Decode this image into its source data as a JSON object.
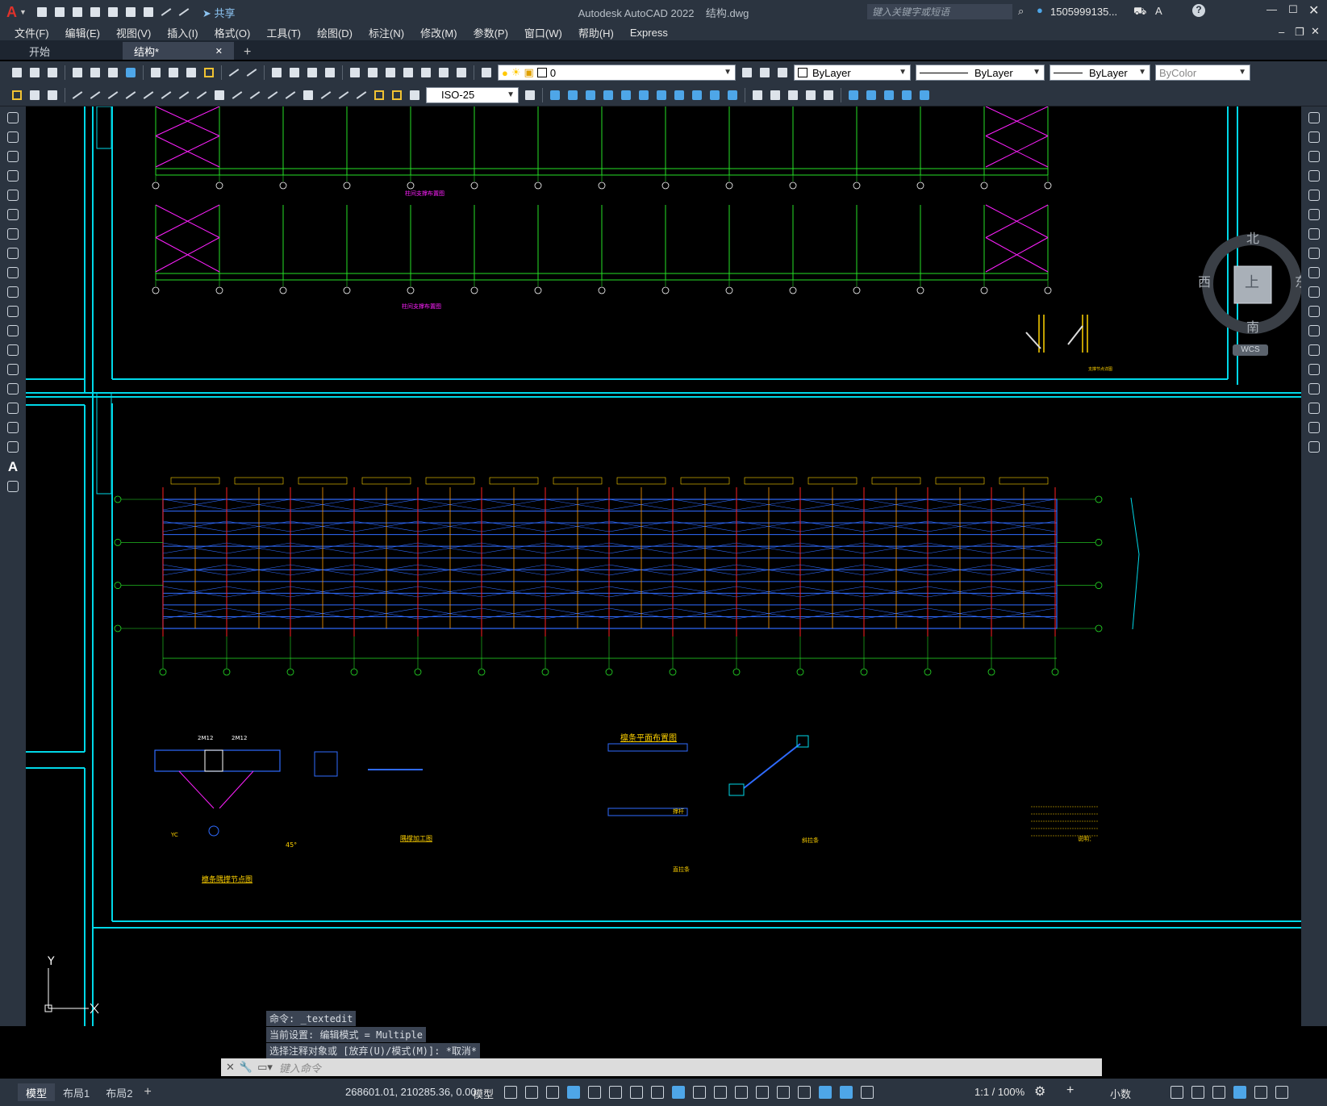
{
  "app": {
    "title": "Autodesk AutoCAD 2022",
    "filename": "结构.dwg",
    "search_placeholder": "键入关键字或短语",
    "user": "1505999135...",
    "share_label": "共享"
  },
  "menu": [
    "文件(F)",
    "编辑(E)",
    "视图(V)",
    "插入(I)",
    "格式(O)",
    "工具(T)",
    "绘图(D)",
    "标注(N)",
    "修改(M)",
    "参数(P)",
    "窗口(W)",
    "帮助(H)",
    "Express"
  ],
  "tabs": [
    {
      "label": "开始",
      "active": false
    },
    {
      "label": "结构*",
      "active": true
    }
  ],
  "toolbar": {
    "layer_value": "0",
    "color_value": "ByLayer",
    "linetype_value": "ByLayer",
    "lineweight_value": "ByLayer",
    "plotstyle_value": "ByColor",
    "dimstyle_value": "ISO-25"
  },
  "viewcube": {
    "north": "北",
    "south": "南",
    "east": "东",
    "west": "西",
    "top": "上",
    "wcs": "WCS"
  },
  "drawing": {
    "ucs_x": "X",
    "ucs_y": "Y",
    "caption_1": "柱间支撑布置图",
    "caption_2": "柱间支撑布置图",
    "caption_3": "支撑节点详图",
    "caption_4": "檩条平面布置图",
    "caption_5": "檩条隅撑节点图",
    "caption_6": "隅撑加工图",
    "caption_7": "直拉条",
    "caption_8": "斜拉条",
    "caption_9": "撑杆",
    "note_title": "说明：",
    "label_2m12_a": "2M12",
    "label_2m12_b": "2M12",
    "label_yc": "YC",
    "angle": "45°"
  },
  "command_history": [
    "命令: _textedit",
    "当前设置: 编辑模式 = Multiple",
    "选择注释对象或 [放弃(U)/模式(M)]: *取消*"
  ],
  "command_placeholder": "键入命令",
  "layout_tabs": [
    {
      "label": "模型",
      "active": true
    },
    {
      "label": "布局1",
      "active": false
    },
    {
      "label": "布局2",
      "active": false
    }
  ],
  "status": {
    "coords": "268601.01, 210285.36, 0.00",
    "mode": "模型",
    "scale": "1:1 / 100%",
    "units": "小数"
  },
  "colors": {
    "cyan": "#00d8e8",
    "green": "#26e026",
    "magenta": "#ff20ff",
    "blue": "#2f6bff",
    "red": "#ff2020",
    "yellow": "#ffd200",
    "orange": "#ff9a00"
  }
}
